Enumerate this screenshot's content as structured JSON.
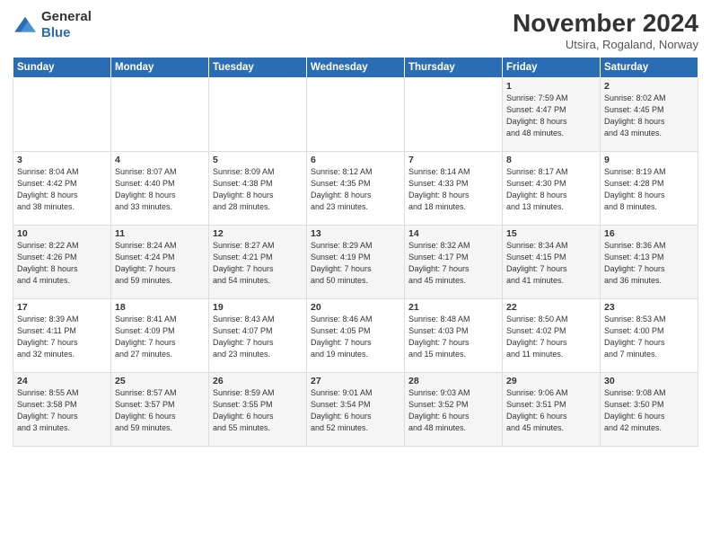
{
  "logo": {
    "general": "General",
    "blue": "Blue"
  },
  "title": {
    "month_year": "November 2024",
    "location": "Utsira, Rogaland, Norway"
  },
  "weekdays": [
    "Sunday",
    "Monday",
    "Tuesday",
    "Wednesday",
    "Thursday",
    "Friday",
    "Saturday"
  ],
  "weeks": [
    [
      {
        "day": "",
        "info": ""
      },
      {
        "day": "",
        "info": ""
      },
      {
        "day": "",
        "info": ""
      },
      {
        "day": "",
        "info": ""
      },
      {
        "day": "",
        "info": ""
      },
      {
        "day": "1",
        "info": "Sunrise: 7:59 AM\nSunset: 4:47 PM\nDaylight: 8 hours\nand 48 minutes."
      },
      {
        "day": "2",
        "info": "Sunrise: 8:02 AM\nSunset: 4:45 PM\nDaylight: 8 hours\nand 43 minutes."
      }
    ],
    [
      {
        "day": "3",
        "info": "Sunrise: 8:04 AM\nSunset: 4:42 PM\nDaylight: 8 hours\nand 38 minutes."
      },
      {
        "day": "4",
        "info": "Sunrise: 8:07 AM\nSunset: 4:40 PM\nDaylight: 8 hours\nand 33 minutes."
      },
      {
        "day": "5",
        "info": "Sunrise: 8:09 AM\nSunset: 4:38 PM\nDaylight: 8 hours\nand 28 minutes."
      },
      {
        "day": "6",
        "info": "Sunrise: 8:12 AM\nSunset: 4:35 PM\nDaylight: 8 hours\nand 23 minutes."
      },
      {
        "day": "7",
        "info": "Sunrise: 8:14 AM\nSunset: 4:33 PM\nDaylight: 8 hours\nand 18 minutes."
      },
      {
        "day": "8",
        "info": "Sunrise: 8:17 AM\nSunset: 4:30 PM\nDaylight: 8 hours\nand 13 minutes."
      },
      {
        "day": "9",
        "info": "Sunrise: 8:19 AM\nSunset: 4:28 PM\nDaylight: 8 hours\nand 8 minutes."
      }
    ],
    [
      {
        "day": "10",
        "info": "Sunrise: 8:22 AM\nSunset: 4:26 PM\nDaylight: 8 hours\nand 4 minutes."
      },
      {
        "day": "11",
        "info": "Sunrise: 8:24 AM\nSunset: 4:24 PM\nDaylight: 7 hours\nand 59 minutes."
      },
      {
        "day": "12",
        "info": "Sunrise: 8:27 AM\nSunset: 4:21 PM\nDaylight: 7 hours\nand 54 minutes."
      },
      {
        "day": "13",
        "info": "Sunrise: 8:29 AM\nSunset: 4:19 PM\nDaylight: 7 hours\nand 50 minutes."
      },
      {
        "day": "14",
        "info": "Sunrise: 8:32 AM\nSunset: 4:17 PM\nDaylight: 7 hours\nand 45 minutes."
      },
      {
        "day": "15",
        "info": "Sunrise: 8:34 AM\nSunset: 4:15 PM\nDaylight: 7 hours\nand 41 minutes."
      },
      {
        "day": "16",
        "info": "Sunrise: 8:36 AM\nSunset: 4:13 PM\nDaylight: 7 hours\nand 36 minutes."
      }
    ],
    [
      {
        "day": "17",
        "info": "Sunrise: 8:39 AM\nSunset: 4:11 PM\nDaylight: 7 hours\nand 32 minutes."
      },
      {
        "day": "18",
        "info": "Sunrise: 8:41 AM\nSunset: 4:09 PM\nDaylight: 7 hours\nand 27 minutes."
      },
      {
        "day": "19",
        "info": "Sunrise: 8:43 AM\nSunset: 4:07 PM\nDaylight: 7 hours\nand 23 minutes."
      },
      {
        "day": "20",
        "info": "Sunrise: 8:46 AM\nSunset: 4:05 PM\nDaylight: 7 hours\nand 19 minutes."
      },
      {
        "day": "21",
        "info": "Sunrise: 8:48 AM\nSunset: 4:03 PM\nDaylight: 7 hours\nand 15 minutes."
      },
      {
        "day": "22",
        "info": "Sunrise: 8:50 AM\nSunset: 4:02 PM\nDaylight: 7 hours\nand 11 minutes."
      },
      {
        "day": "23",
        "info": "Sunrise: 8:53 AM\nSunset: 4:00 PM\nDaylight: 7 hours\nand 7 minutes."
      }
    ],
    [
      {
        "day": "24",
        "info": "Sunrise: 8:55 AM\nSunset: 3:58 PM\nDaylight: 7 hours\nand 3 minutes."
      },
      {
        "day": "25",
        "info": "Sunrise: 8:57 AM\nSunset: 3:57 PM\nDaylight: 6 hours\nand 59 minutes."
      },
      {
        "day": "26",
        "info": "Sunrise: 8:59 AM\nSunset: 3:55 PM\nDaylight: 6 hours\nand 55 minutes."
      },
      {
        "day": "27",
        "info": "Sunrise: 9:01 AM\nSunset: 3:54 PM\nDaylight: 6 hours\nand 52 minutes."
      },
      {
        "day": "28",
        "info": "Sunrise: 9:03 AM\nSunset: 3:52 PM\nDaylight: 6 hours\nand 48 minutes."
      },
      {
        "day": "29",
        "info": "Sunrise: 9:06 AM\nSunset: 3:51 PM\nDaylight: 6 hours\nand 45 minutes."
      },
      {
        "day": "30",
        "info": "Sunrise: 9:08 AM\nSunset: 3:50 PM\nDaylight: 6 hours\nand 42 minutes."
      }
    ]
  ]
}
